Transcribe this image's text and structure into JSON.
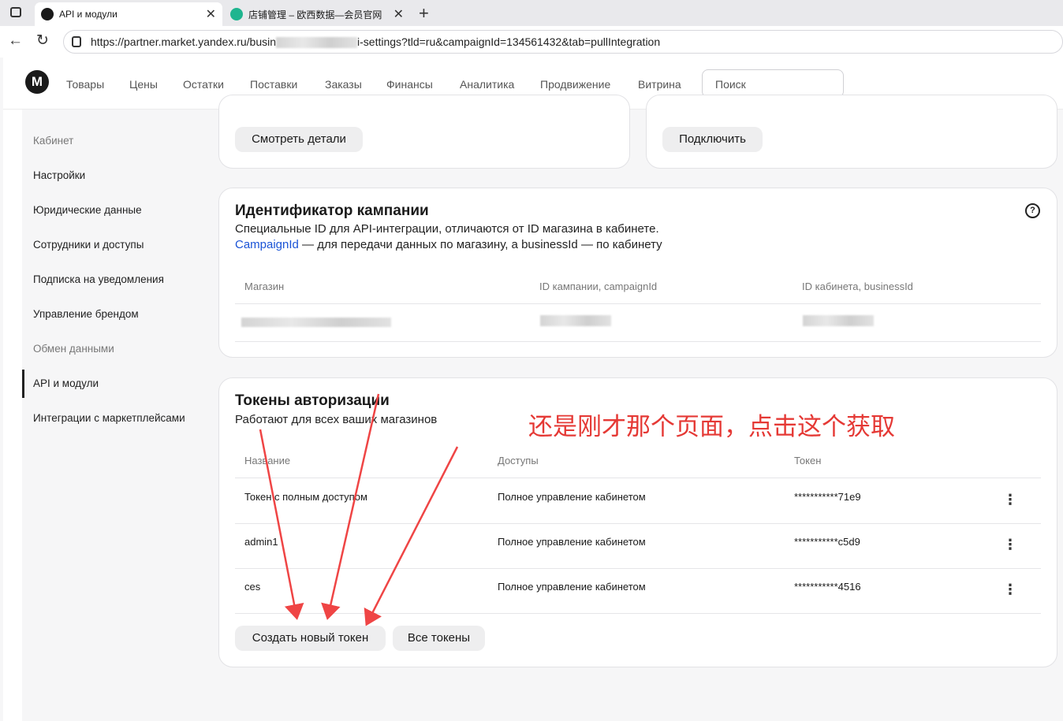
{
  "browser": {
    "tabs": [
      {
        "title": "API и модули"
      },
      {
        "title": "店铺管理 – 欧西数据—会员官网"
      }
    ],
    "url": {
      "prefix": "https://partner.market.yandex.ru/busin",
      "suffix": "i-settings?tld=ru&campaignId=134561432&tab=pullIntegration"
    }
  },
  "header": {
    "logo": "M",
    "nav": [
      "Товары",
      "Цены",
      "Остатки",
      "Поставки",
      "Заказы",
      "Финансы",
      "Аналитика",
      "Продвижение",
      "Витрина"
    ],
    "search_placeholder": "Поиск"
  },
  "sidebar": {
    "items": [
      {
        "label": "Кабинет",
        "muted": true
      },
      {
        "label": "Настройки"
      },
      {
        "label": "Юридические данные"
      },
      {
        "label": "Сотрудники и доступы"
      },
      {
        "label": "Подписка на уведомления"
      },
      {
        "label": "Управление брендом"
      },
      {
        "label": "Обмен данными",
        "muted": true
      },
      {
        "label": "API и модули",
        "active": true
      },
      {
        "label": "Интеграции с маркетплейсами"
      }
    ]
  },
  "top_cards": {
    "left_button": "Смотреть детали",
    "right_button": "Подключить"
  },
  "campaign": {
    "title": "Идентификатор кампании",
    "description": "Специальные ID для API-интеграции, отличаются от ID магазина в кабинете.",
    "link": "CampaignId",
    "description2": " — для передачи данных по магазину, а businessId — по кабинету",
    "columns": [
      "Магазин",
      "ID кампании, campaignId",
      "ID кабинета, businessId"
    ]
  },
  "tokens": {
    "title": "Токены авторизации",
    "subtitle": "Работают для всех ваших магазинов",
    "columns": [
      "Название",
      "Доступы",
      "Токен"
    ],
    "rows": [
      {
        "name": "Токен с полным доступом",
        "access": "Полное управление кабинетом",
        "token": "***********71e9"
      },
      {
        "name": "admin1",
        "access": "Полное управление кабинетом",
        "token": "***********c5d9"
      },
      {
        "name": "ces",
        "access": "Полное управление кабинетом",
        "token": "***********4516"
      }
    ],
    "create_button": "Создать новый токен",
    "all_button": "Все токены"
  },
  "annotation": "还是刚才那个页面，点击这个获取",
  "colors": {
    "annotation": "#e53935",
    "link": "#1a53d6"
  }
}
